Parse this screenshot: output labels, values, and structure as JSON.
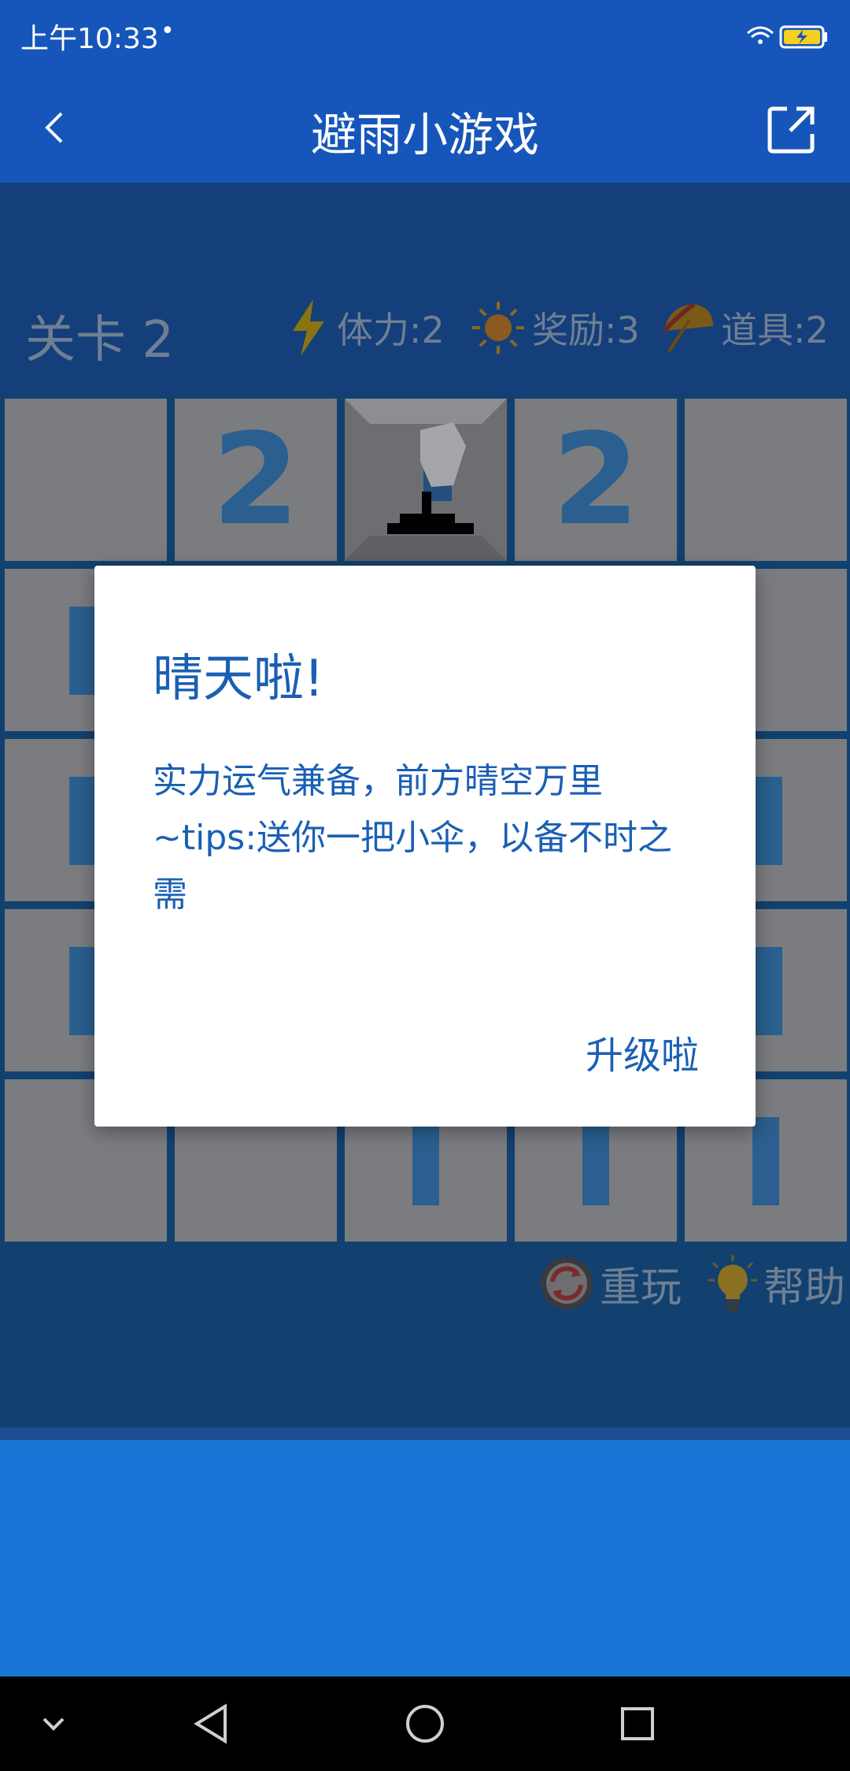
{
  "status": {
    "time": "上午10:33",
    "dot": "•"
  },
  "appbar": {
    "title": "避雨小游戏",
    "back_icon": "chevron-left-icon",
    "share_icon": "external-link-icon"
  },
  "hud": {
    "level": "关卡 2",
    "stamina": "体力:2",
    "reward": "奖励:3",
    "props": "道具:2"
  },
  "grid": {
    "row0": [
      "",
      "2",
      "",
      "2",
      ""
    ]
  },
  "controls": {
    "replay": "重玩",
    "help": "帮助"
  },
  "dialog": {
    "title": "晴天啦!",
    "message": "实力运气兼备，前方晴空万里\n~tips:送你一把小伞，以备不时之需",
    "ok": "升级啦"
  },
  "colors": {
    "primary": "#1656bb",
    "accent": "#1a5fb4",
    "game_bg": "#153f7b"
  }
}
